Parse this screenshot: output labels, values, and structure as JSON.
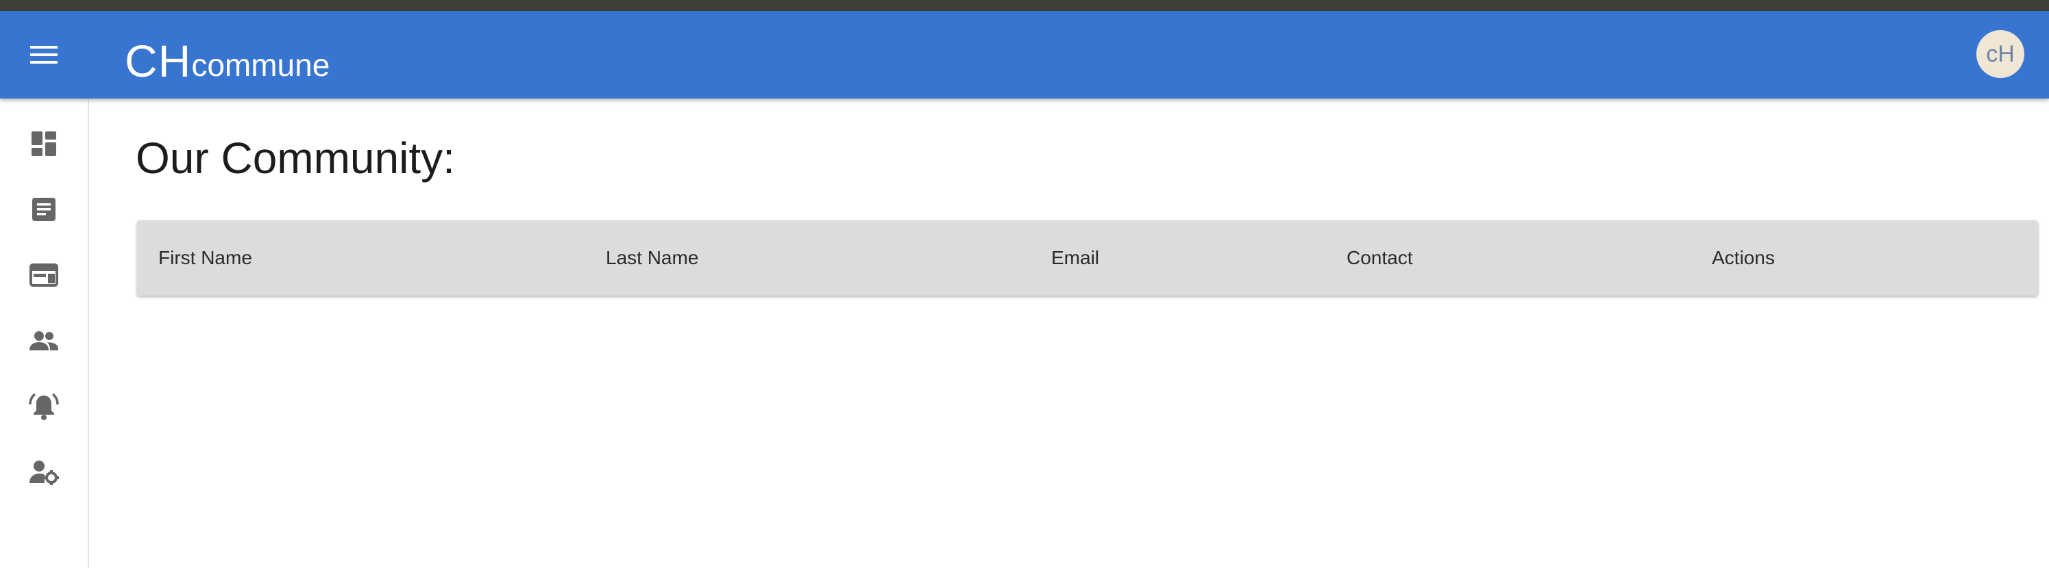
{
  "header": {
    "menu_icon": "menu-icon",
    "brand_big": "CH",
    "brand_small": "commune",
    "avatar_text": "cH",
    "color": "#3875d0"
  },
  "sidebar": {
    "items": [
      {
        "icon": "dashboard-icon"
      },
      {
        "icon": "article-icon"
      },
      {
        "icon": "web-icon"
      },
      {
        "icon": "people-icon"
      },
      {
        "icon": "notifications-active-icon"
      },
      {
        "icon": "manage-accounts-icon"
      }
    ],
    "icon_color": "#666666"
  },
  "main": {
    "title": "Our Community:",
    "table": {
      "columns": [
        "First Name",
        "Last Name",
        "Email",
        "Contact",
        "Actions"
      ],
      "rows": []
    }
  }
}
